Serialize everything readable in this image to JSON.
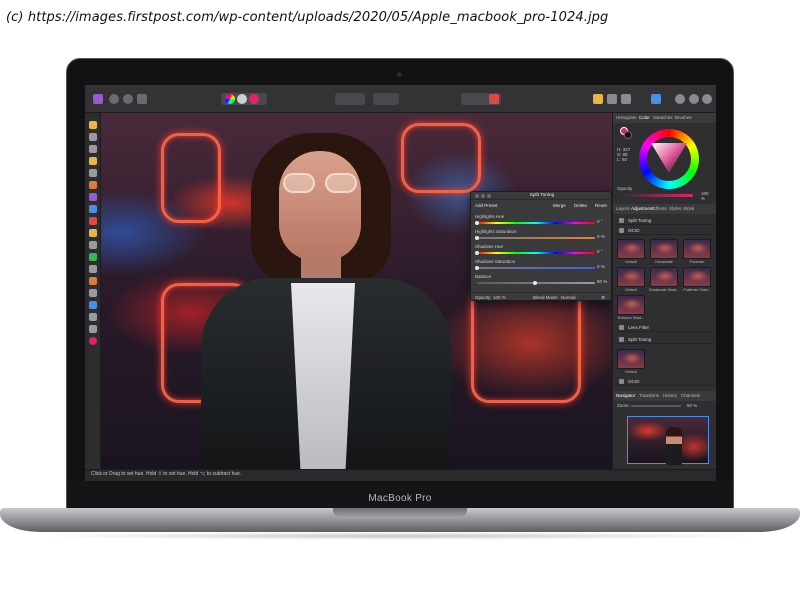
{
  "credit": "(c) https://images.firstpost.com/wp-content/uploads/2020/05/Apple_macbook_pro-1024.jpg",
  "device": {
    "model": "MacBook Pro"
  },
  "app": {
    "status_text": "Click or Drag to set hue. Hold ⇧ to set hue. Hold ⌥ to subtract hue.",
    "panel_tabs": [
      "Histogram",
      "Color",
      "Swatches",
      "Brushes"
    ],
    "panel_tabs_active": "Color",
    "color": {
      "hsl_text": "H: 327\nS: 88\nL: 50",
      "opacity_label": "Opacity",
      "opacity_value": "100 %",
      "foreground": "#e0246a"
    },
    "layer_tabs": [
      "Layers",
      "Adjustment",
      "Effects",
      "Styles",
      "Stock"
    ],
    "layer_tabs_active": "Adjustment",
    "adjustments": [
      {
        "label": "Split Toning"
      },
      {
        "label": "OCIO"
      }
    ],
    "thumbnails": [
      {
        "label": "Default"
      },
      {
        "label": "Desaturate"
      },
      {
        "label": "Posterize"
      },
      {
        "label": "Default"
      },
      {
        "label": "Desaturate Shad..."
      },
      {
        "label": "Posterize Shad..."
      },
      {
        "label": "Enhance Shad..."
      }
    ],
    "adjust_items": [
      {
        "label": "Lens Filter"
      },
      {
        "label": "Split Toning"
      }
    ],
    "default_label": "Default",
    "ocio_label": "OCIO",
    "navigator_tabs": [
      "Navigator",
      "Transform",
      "History",
      "Channels"
    ],
    "navigator_tabs_active": "Navigator",
    "zoom_label": "Zoom:",
    "zoom_value": "50 %"
  },
  "dialog": {
    "title": "Split Toning",
    "buttons": [
      "Add Preset",
      "Merge",
      "Delete",
      "Reset"
    ],
    "rows": [
      {
        "label": "Highlights Hue",
        "value": "0 °",
        "level": 0.0
      },
      {
        "label": "Highlights Saturation",
        "value": "0 %",
        "level": 0.0
      },
      {
        "label": "Shadows Hue",
        "value": "0 °",
        "level": 0.0
      },
      {
        "label": "Shadows Saturation",
        "value": "0 %",
        "level": 0.0
      },
      {
        "label": "Balance",
        "value": "50 %",
        "level": 0.5
      }
    ],
    "footer": {
      "opacity_label": "Opacity:",
      "opacity_value": "100 %",
      "blend_label": "Blend Mode:",
      "blend_value": "Normal"
    }
  }
}
